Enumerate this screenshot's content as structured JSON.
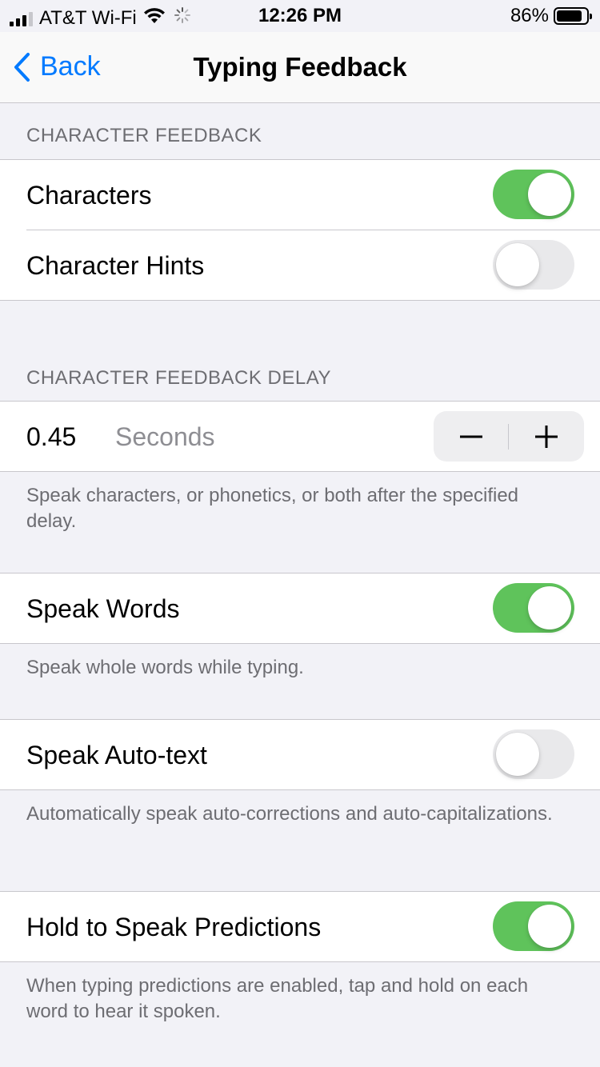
{
  "status_bar": {
    "carrier": "AT&T Wi-Fi",
    "time": "12:26 PM",
    "battery_percent": "86%",
    "battery_level": 0.86
  },
  "nav": {
    "back_label": "Back",
    "title": "Typing Feedback"
  },
  "character_feedback": {
    "header": "CHARACTER FEEDBACK",
    "rows": [
      {
        "label": "Characters",
        "on": true
      },
      {
        "label": "Character Hints",
        "on": false
      }
    ]
  },
  "delay": {
    "header": "CHARACTER FEEDBACK DELAY",
    "value": "0.45",
    "unit": "Seconds",
    "footer": "Speak characters, or phonetics, or both after the specified delay."
  },
  "speak_words": {
    "label": "Speak Words",
    "on": true,
    "footer": "Speak whole words while typing."
  },
  "speak_autotext": {
    "label": "Speak Auto-text",
    "on": false,
    "footer": "Automatically speak auto-corrections and auto-capitalizations."
  },
  "hold_predictions": {
    "label": "Hold to Speak Predictions",
    "on": true,
    "footer": "When typing predictions are enabled, tap and hold on each word to hear it spoken."
  },
  "colors": {
    "accent": "#007aff",
    "toggle_on": "#5fc35b",
    "toggle_off": "#e9e9eb",
    "background": "#f2f2f7"
  }
}
